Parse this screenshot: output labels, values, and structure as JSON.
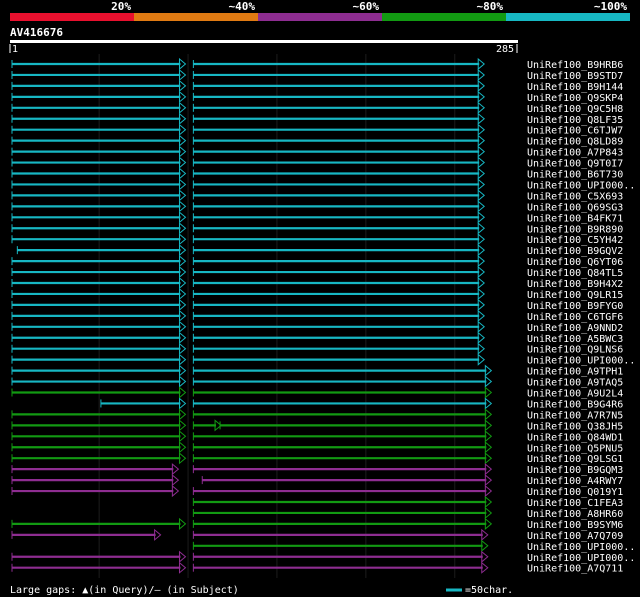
{
  "identity_scale": {
    "labels": [
      "20%",
      "~40%",
      "~60%",
      "~80%",
      "~100%"
    ],
    "colors": [
      "#e8102e",
      "#e07a12",
      "#8e2d91",
      "#129a12",
      "#17b7c3"
    ]
  },
  "query": {
    "id": "AV416676",
    "start": "1",
    "end": "285"
  },
  "hits": [
    {
      "name": "UniRef100_B9HRB6",
      "color": "#17b7c3",
      "segs": [
        [
          1,
          98,
          "a"
        ],
        [
          103,
          266,
          "a"
        ]
      ]
    },
    {
      "name": "UniRef100_B9STD7",
      "color": "#17b7c3",
      "segs": [
        [
          1,
          98,
          "a"
        ],
        [
          103,
          266,
          "a"
        ]
      ]
    },
    {
      "name": "UniRef100_B9H144",
      "color": "#17b7c3",
      "segs": [
        [
          1,
          98,
          "a"
        ],
        [
          103,
          266,
          "a"
        ]
      ]
    },
    {
      "name": "UniRef100_Q9SKP4",
      "color": "#17b7c3",
      "segs": [
        [
          1,
          98,
          "a"
        ],
        [
          103,
          266,
          "a"
        ]
      ]
    },
    {
      "name": "UniRef100_Q9C5H8",
      "color": "#17b7c3",
      "segs": [
        [
          1,
          98,
          "a"
        ],
        [
          103,
          266,
          "a"
        ]
      ]
    },
    {
      "name": "UniRef100_Q8LF35",
      "color": "#17b7c3",
      "segs": [
        [
          1,
          98,
          "a"
        ],
        [
          103,
          266,
          "a"
        ]
      ]
    },
    {
      "name": "UniRef100_C6TJW7",
      "color": "#17b7c3",
      "segs": [
        [
          1,
          98,
          "a"
        ],
        [
          103,
          266,
          "a"
        ]
      ]
    },
    {
      "name": "UniRef100_Q8LD89",
      "color": "#17b7c3",
      "segs": [
        [
          1,
          98,
          "a"
        ],
        [
          103,
          266,
          "a"
        ]
      ]
    },
    {
      "name": "UniRef100_A7P843",
      "color": "#17b7c3",
      "segs": [
        [
          1,
          98,
          "a"
        ],
        [
          103,
          266,
          "a"
        ]
      ]
    },
    {
      "name": "UniRef100_Q9T0I7",
      "color": "#17b7c3",
      "segs": [
        [
          1,
          98,
          "a"
        ],
        [
          103,
          266,
          "a"
        ]
      ]
    },
    {
      "name": "UniRef100_B6T730",
      "color": "#17b7c3",
      "segs": [
        [
          1,
          98,
          "a"
        ],
        [
          103,
          266,
          "a"
        ]
      ]
    },
    {
      "name": "UniRef100_UPI000..",
      "color": "#17b7c3",
      "segs": [
        [
          1,
          98,
          "a"
        ],
        [
          103,
          266,
          "a"
        ]
      ]
    },
    {
      "name": "UniRef100_C5X693",
      "color": "#17b7c3",
      "segs": [
        [
          1,
          98,
          "b"
        ],
        [
          103,
          266,
          "b"
        ]
      ]
    },
    {
      "name": "UniRef100_Q69SG3",
      "color": "#17b7c3",
      "segs": [
        [
          1,
          98,
          "b"
        ],
        [
          103,
          266,
          "b"
        ]
      ]
    },
    {
      "name": "UniRef100_B4FK71",
      "color": "#17b7c3",
      "segs": [
        [
          1,
          98,
          "b"
        ],
        [
          103,
          266,
          "b"
        ]
      ]
    },
    {
      "name": "UniRef100_B9R890",
      "color": "#17b7c3",
      "segs": [
        [
          1,
          98,
          "b"
        ],
        [
          103,
          266,
          "b"
        ]
      ]
    },
    {
      "name": "UniRef100_C5YH42",
      "color": "#17b7c3",
      "segs": [
        [
          1,
          98,
          "b"
        ],
        [
          103,
          266,
          "b"
        ]
      ]
    },
    {
      "name": "UniRef100_B9GQV2",
      "color": "#17b7c3",
      "segs": [
        [
          4,
          98,
          "b"
        ],
        [
          103,
          266,
          "b"
        ]
      ]
    },
    {
      "name": "UniRef100_Q6YT06",
      "color": "#17b7c3",
      "segs": [
        [
          1,
          98,
          "b"
        ],
        [
          103,
          266,
          "b"
        ]
      ]
    },
    {
      "name": "UniRef100_Q84TL5",
      "color": "#17b7c3",
      "segs": [
        [
          1,
          98,
          "b"
        ],
        [
          103,
          266,
          "b"
        ]
      ]
    },
    {
      "name": "UniRef100_B9H4X2",
      "color": "#17b7c3",
      "segs": [
        [
          1,
          98,
          "b"
        ],
        [
          103,
          266,
          "b"
        ]
      ]
    },
    {
      "name": "UniRef100_Q9LR15",
      "color": "#17b7c3",
      "segs": [
        [
          1,
          98,
          "b"
        ],
        [
          103,
          266,
          "b"
        ]
      ]
    },
    {
      "name": "UniRef100_B9FYG0",
      "color": "#17b7c3",
      "segs": [
        [
          1,
          98,
          "b"
        ],
        [
          103,
          266,
          "b"
        ]
      ]
    },
    {
      "name": "UniRef100_C6TGF6",
      "color": "#17b7c3",
      "segs": [
        [
          1,
          98,
          "b"
        ],
        [
          103,
          266,
          "b"
        ]
      ]
    },
    {
      "name": "UniRef100_A9NND2",
      "color": "#17b7c3",
      "segs": [
        [
          1,
          98,
          "b"
        ],
        [
          103,
          266,
          "b"
        ]
      ]
    },
    {
      "name": "UniRef100_A5BWC3",
      "color": "#17b7c3",
      "segs": [
        [
          1,
          98,
          "b"
        ],
        [
          103,
          266,
          "b"
        ]
      ]
    },
    {
      "name": "UniRef100_Q9LNS6",
      "color": "#17b7c3",
      "segs": [
        [
          1,
          98,
          "b"
        ],
        [
          103,
          266,
          "b"
        ]
      ]
    },
    {
      "name": "UniRef100_UPI000..",
      "color": "#17b7c3",
      "segs": [
        [
          1,
          98,
          "b"
        ],
        [
          103,
          266,
          "b"
        ]
      ]
    },
    {
      "name": "UniRef100_A9TPH1",
      "color": "#17b7c3",
      "segs": [
        [
          1,
          98,
          "b"
        ],
        [
          103,
          270,
          "b"
        ]
      ]
    },
    {
      "name": "UniRef100_A9TAQ5",
      "color": "#17b7c3",
      "segs": [
        [
          1,
          98,
          "b"
        ],
        [
          103,
          270,
          "b"
        ]
      ]
    },
    {
      "name": "UniRef100_A9U2L4",
      "color": "#129a12",
      "segs": [
        [
          1,
          98,
          "b"
        ],
        [
          103,
          270,
          "b"
        ]
      ]
    },
    {
      "name": "UniRef100_B9G4R6",
      "color": "#17b7c3",
      "segs": [
        [
          51,
          98,
          "b"
        ],
        [
          103,
          270,
          "b"
        ]
      ]
    },
    {
      "name": "UniRef100_A7R7N5",
      "color": "#129a12",
      "segs": [
        [
          1,
          98,
          "b"
        ],
        [
          103,
          270,
          "b"
        ]
      ]
    },
    {
      "name": "UniRef100_Q38JH5",
      "color": "#129a12",
      "segs": [
        [
          1,
          98,
          "b"
        ],
        [
          103,
          118,
          "b"
        ],
        [
          118,
          270,
          "b"
        ]
      ]
    },
    {
      "name": "UniRef100_Q84WD1",
      "color": "#129a12",
      "segs": [
        [
          1,
          98,
          "b"
        ],
        [
          103,
          270,
          "b"
        ]
      ]
    },
    {
      "name": "UniRef100_Q5PNU5",
      "color": "#129a12",
      "segs": [
        [
          1,
          98,
          "b"
        ],
        [
          103,
          270,
          "b"
        ]
      ]
    },
    {
      "name": "UniRef100_Q9LSG1",
      "color": "#129a12",
      "segs": [
        [
          1,
          98,
          "b"
        ],
        [
          103,
          270,
          "b"
        ]
      ]
    },
    {
      "name": "UniRef100_B9GQM3",
      "color": "#8e2d91",
      "segs": [
        [
          1,
          94,
          "b"
        ],
        [
          103,
          270,
          "b"
        ]
      ]
    },
    {
      "name": "UniRef100_A4RWY7",
      "color": "#8e2d91",
      "segs": [
        [
          1,
          94,
          "b"
        ],
        [
          108,
          270,
          "b"
        ]
      ]
    },
    {
      "name": "UniRef100_Q019Y1",
      "color": "#8e2d91",
      "segs": [
        [
          1,
          94,
          "b"
        ],
        [
          103,
          270,
          "b"
        ]
      ]
    },
    {
      "name": "UniRef100_C1FEA3",
      "color": "#129a12",
      "segs": [
        [
          103,
          270,
          "b"
        ]
      ]
    },
    {
      "name": "UniRef100_A8HR60",
      "color": "#129a12",
      "segs": [
        [
          103,
          270,
          "b"
        ]
      ]
    },
    {
      "name": "UniRef100_B9SYM6",
      "color": "#129a12",
      "segs": [
        [
          1,
          98,
          "b"
        ],
        [
          103,
          270,
          "b"
        ]
      ]
    },
    {
      "name": "UniRef100_A7Q709",
      "color": "#8e2d91",
      "segs": [
        [
          1,
          84,
          "b"
        ],
        [
          103,
          268,
          "b"
        ]
      ]
    },
    {
      "name": "UniRef100_UPI000..",
      "color": "#129a12",
      "segs": [
        [
          103,
          268,
          "b"
        ]
      ]
    },
    {
      "name": "UniRef100_UPI000..",
      "color": "#8e2d91",
      "segs": [
        [
          1,
          98,
          "b"
        ],
        [
          103,
          268,
          "b"
        ]
      ]
    },
    {
      "name": "UniRef100_A7Q711",
      "color": "#8e2d91",
      "segs": [
        [
          1,
          98,
          "b"
        ],
        [
          103,
          268,
          "b"
        ]
      ]
    }
  ],
  "legend": {
    "gaps_text": "Large gaps: ▲(in Query)/— (in Subject)",
    "scale_text": "=50char.",
    "scale_color": "#17b7c3"
  }
}
